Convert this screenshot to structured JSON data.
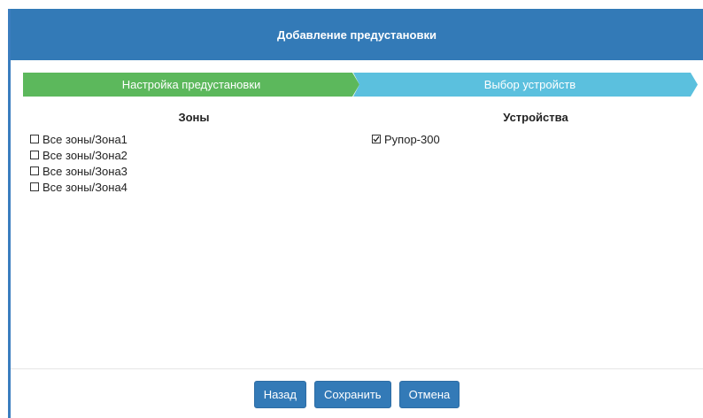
{
  "dialog": {
    "title": "Добавление предустановки"
  },
  "wizard": {
    "steps": [
      {
        "label": "Настройка предустановки",
        "state": "active"
      },
      {
        "label": "Выбор устройств",
        "state": "pending"
      }
    ]
  },
  "zones": {
    "title": "Зоны",
    "items": [
      {
        "label": "Все зоны/Зона1",
        "checked": false
      },
      {
        "label": "Все зоны/Зона2",
        "checked": false
      },
      {
        "label": "Все зоны/Зона3",
        "checked": false
      },
      {
        "label": "Все зоны/Зона4",
        "checked": false
      }
    ]
  },
  "devices": {
    "title": "Устройства",
    "items": [
      {
        "label": "Рупор-300",
        "checked": true
      }
    ]
  },
  "footer": {
    "back_label": "Назад",
    "save_label": "Сохранить",
    "cancel_label": "Отмена"
  },
  "colors": {
    "header": "#337ab7",
    "step_active": "#5cb85c",
    "step_pending": "#5bc0de",
    "button": "#337ab7"
  }
}
